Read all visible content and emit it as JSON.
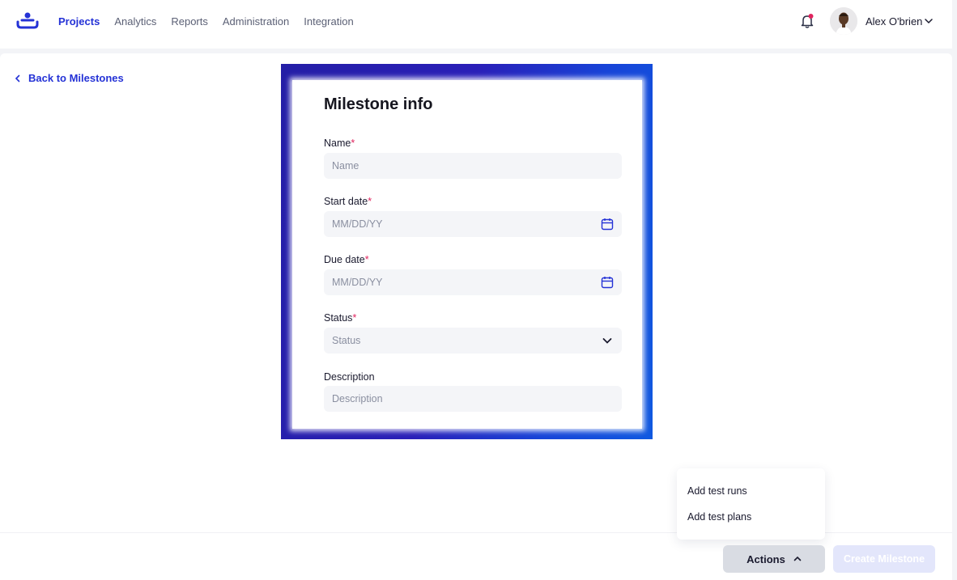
{
  "header": {
    "nav": [
      {
        "label": "Projects",
        "active": true
      },
      {
        "label": "Analytics"
      },
      {
        "label": "Reports"
      },
      {
        "label": "Administration"
      },
      {
        "label": "Integration"
      }
    ],
    "user_name": "Alex O'brien",
    "notification_icon": "bell-icon",
    "notification_dot_color": "#e0245e"
  },
  "back_link": "Back to Milestones",
  "form": {
    "title": "Milestone info",
    "required_marker": "*",
    "name": {
      "label": "Name",
      "placeholder": "Name"
    },
    "start_date": {
      "label": "Start date",
      "placeholder": "MM/DD/YY",
      "icon": "calendar-icon"
    },
    "due_date": {
      "label": "Due date",
      "placeholder": "MM/DD/YY",
      "icon": "calendar-icon"
    },
    "status": {
      "label": "Status",
      "placeholder": "Status",
      "icon": "chevron-down-icon"
    },
    "description": {
      "label": "Description",
      "placeholder": "Description"
    }
  },
  "actions_menu": {
    "items": [
      "Add test runs",
      "Add test plans"
    ]
  },
  "footer": {
    "actions_label": "Actions",
    "create_label": "Create Milestone"
  },
  "colors": {
    "accent": "#2432d6",
    "required": "#e0245e"
  }
}
